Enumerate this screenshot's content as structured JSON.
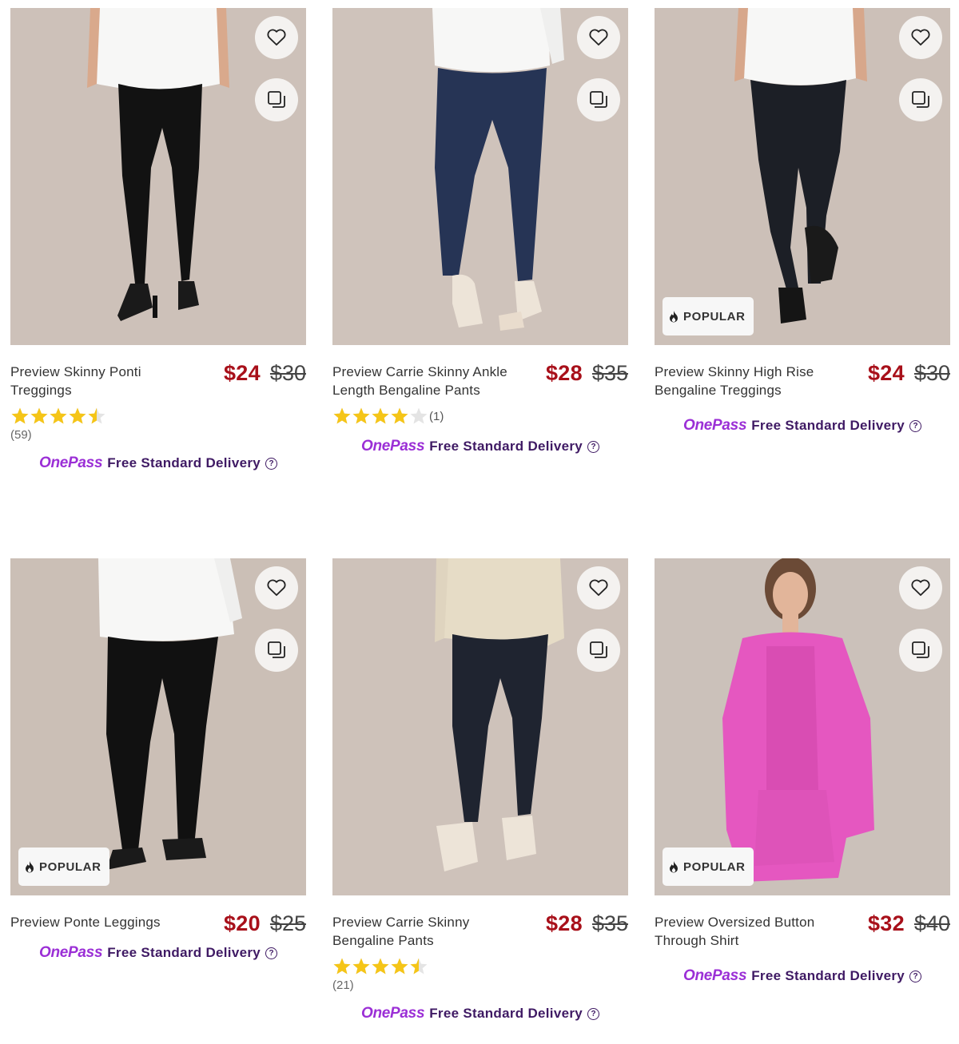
{
  "products": [
    {
      "name": "Preview Skinny Ponti Treggings",
      "price_now": "$24",
      "price_was": "$30",
      "rating": 4.5,
      "review_count": "(59)",
      "popular_label": "",
      "delivery_brand": "OnePass",
      "delivery_text": "Free Standard Delivery"
    },
    {
      "name": "Preview Carrie Skinny Ankle Length Bengaline Pants",
      "price_now": "$28",
      "price_was": "$35",
      "rating": 4,
      "review_count": "(1)",
      "popular_label": "",
      "delivery_brand": "OnePass",
      "delivery_text": "Free Standard Delivery"
    },
    {
      "name": "Preview Skinny High Rise Bengaline Treggings",
      "price_now": "$24",
      "price_was": "$30",
      "rating": null,
      "review_count": "",
      "popular_label": "POPULAR",
      "delivery_brand": "OnePass",
      "delivery_text": "Free Standard Delivery"
    },
    {
      "name": "Preview Ponte Leggings",
      "price_now": "$20",
      "price_was": "$25",
      "rating": null,
      "review_count": "",
      "popular_label": "POPULAR",
      "delivery_brand": "OnePass",
      "delivery_text": "Free Standard Delivery"
    },
    {
      "name": "Preview Carrie Skinny Bengaline Pants",
      "price_now": "$28",
      "price_was": "$35",
      "rating": 4.5,
      "review_count": "(21)",
      "popular_label": "",
      "delivery_brand": "OnePass",
      "delivery_text": "Free Standard Delivery"
    },
    {
      "name": "Preview Oversized Button Through Shirt",
      "price_now": "$32",
      "price_was": "$40",
      "rating": null,
      "review_count": "",
      "popular_label": "POPULAR",
      "delivery_brand": "OnePass",
      "delivery_text": "Free Standard Delivery"
    }
  ],
  "colors": {
    "price_now": "#a8101a",
    "onepass": "#9b2fd6",
    "delivery_text": "#3f1a64",
    "star": "#f5c518"
  },
  "icons": {
    "wishlist": "heart-icon",
    "compare": "compare-icon",
    "popular": "flame-icon",
    "help": "question-circle-icon"
  }
}
